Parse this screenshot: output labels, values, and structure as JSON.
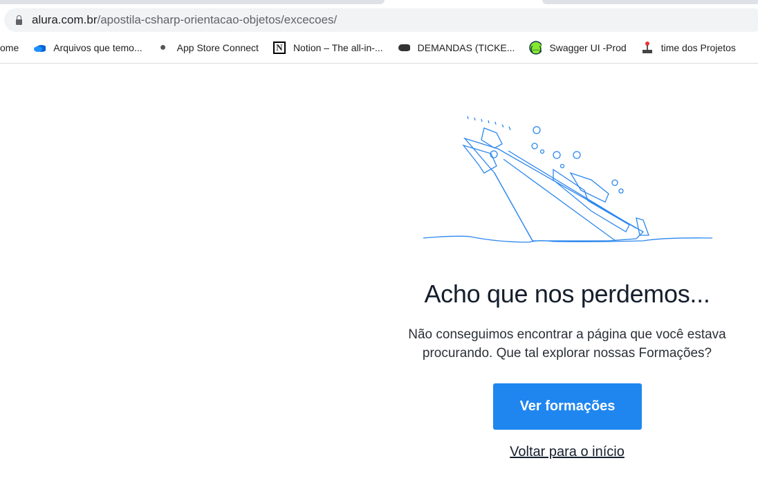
{
  "browser": {
    "url_host": "alura.com.br",
    "url_path": "/apostila-csharp-orientacao-objetos/excecoes/",
    "bookmarks": [
      {
        "label": "ome",
        "icon": "none"
      },
      {
        "label": "Arquivos que temo...",
        "icon": "onedrive-cloud-icon"
      },
      {
        "label": "App Store Connect",
        "icon": "apple-icon"
      },
      {
        "label": "Notion – The all-in-...",
        "icon": "notion-icon"
      },
      {
        "label": "DEMANDAS (TICKE...",
        "icon": "gamepad-icon"
      },
      {
        "label": "Swagger UI -Prod",
        "icon": "swagger-icon"
      },
      {
        "label": "time dos Projetos",
        "icon": "joystick-icon"
      }
    ]
  },
  "page": {
    "title": "Acho que nos perdemos...",
    "description": "Não conseguimos encontrar a página que você estava procurando. Que tal explorar nossas Formações?",
    "primary_button": "Ver formações",
    "back_link": "Voltar para o início",
    "accent_color": "#1f86f0",
    "illustration": "sinking-ship-illustration"
  }
}
